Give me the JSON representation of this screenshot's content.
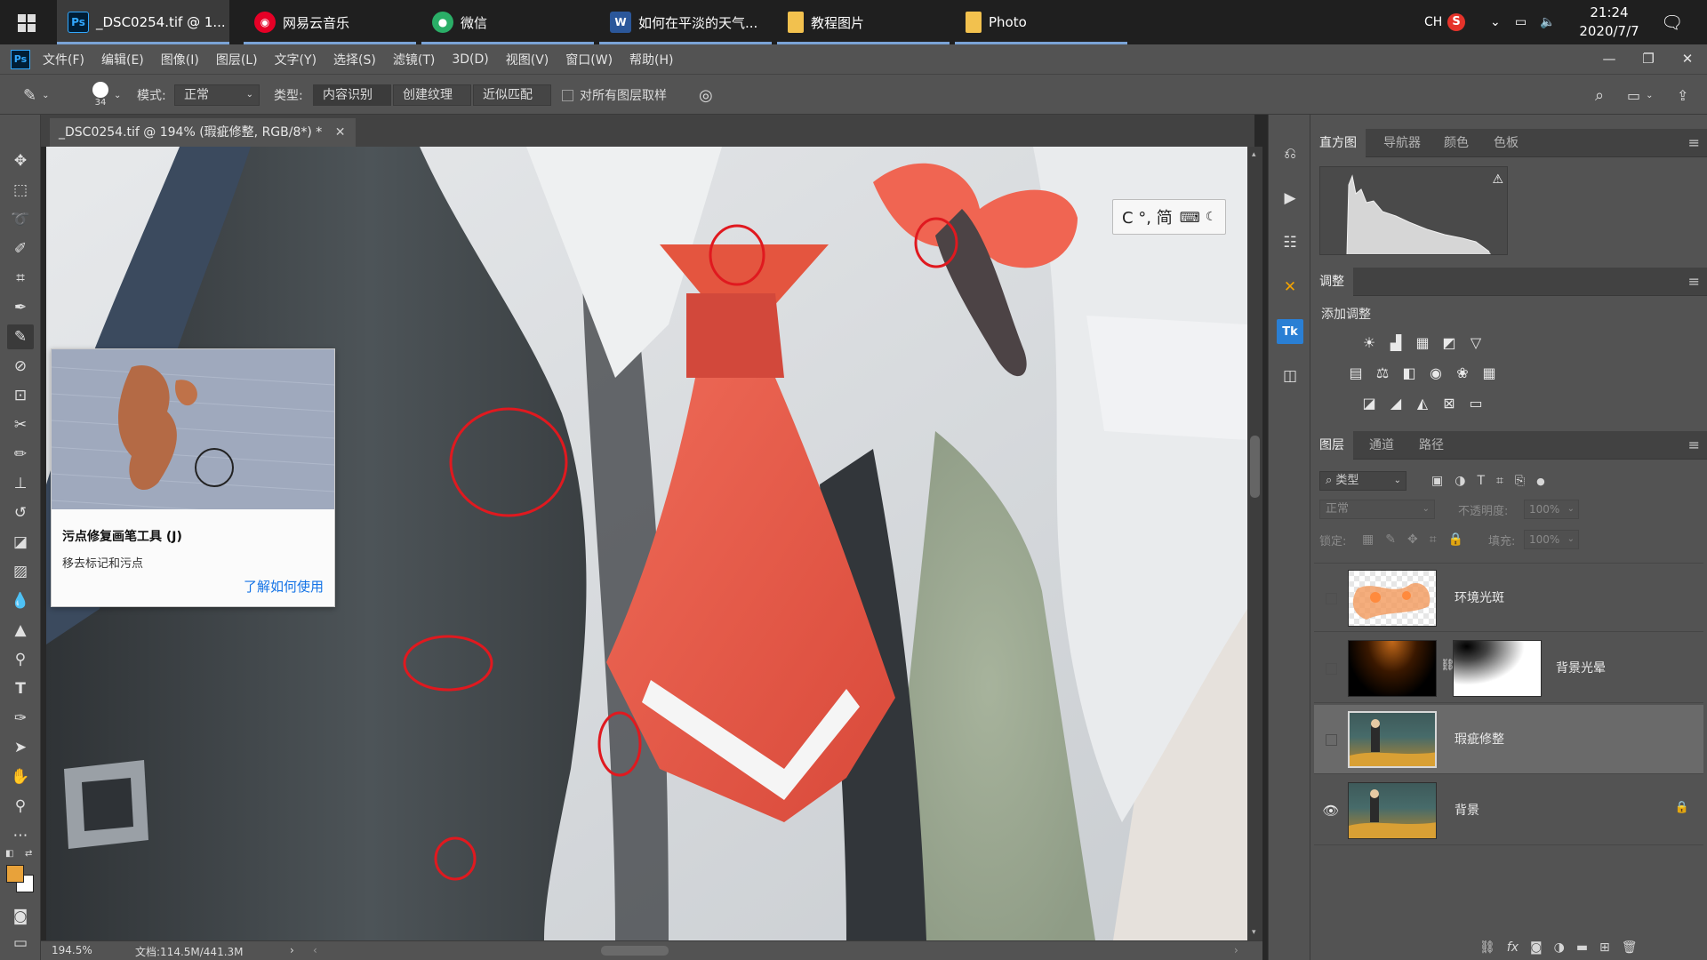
{
  "taskbar": {
    "items": [
      {
        "label": "_DSC0254.tif @ 1...",
        "icon": "photoshop-icon",
        "badge": "Ps",
        "color": "#31a8ff",
        "bg": "#001e36",
        "active": true
      },
      {
        "label": "网易云音乐",
        "icon": "netease-music-icon",
        "badge": "◉",
        "color": "#ffffff",
        "bg": "#e60026",
        "active": false
      },
      {
        "label": "微信",
        "icon": "wechat-icon",
        "badge": "●",
        "color": "#ffffff",
        "bg": "#2aae67",
        "active": false
      },
      {
        "label": "如何在平淡的天气...",
        "icon": "word-icon",
        "badge": "W",
        "color": "#ffffff",
        "bg": "#2b579a",
        "active": false
      },
      {
        "label": "教程图片",
        "icon": "folder-icon",
        "badge": "",
        "color": "#f2c14e",
        "bg": "#f2c14e",
        "active": false
      },
      {
        "label": "Photo",
        "icon": "folder-icon",
        "badge": "",
        "color": "#f2c14e",
        "bg": "#f2c14e",
        "active": false
      }
    ],
    "ime_indicator": "CH",
    "time": "21:24",
    "date": "2020/7/7"
  },
  "menu": {
    "logo": "Ps",
    "items": [
      "文件(F)",
      "编辑(E)",
      "图像(I)",
      "图层(L)",
      "文字(Y)",
      "选择(S)",
      "滤镜(T)",
      "3D(D)",
      "视图(V)",
      "窗口(W)",
      "帮助(H)"
    ]
  },
  "options": {
    "brush_size": "34",
    "mode_label": "模式:",
    "mode_value": "正常",
    "type_label": "类型:",
    "type_options": [
      "内容识别",
      "创建纹理",
      "近似匹配"
    ],
    "type_selected": "内容识别",
    "sample_all_label": "对所有图层取样"
  },
  "document": {
    "tab_title": "_DSC0254.tif @ 194% (瑕疵修整, RGB/8*) *",
    "zoom": "194.5%",
    "doc_size": "文档:114.5M/441.3M"
  },
  "tooltip": {
    "title": "污点修复画笔工具 (J)",
    "description": "移去标记和污点",
    "link": "了解如何使用"
  },
  "ime_bar": {
    "text": "C °, 简"
  },
  "histogram_panel": {
    "tabs": [
      "直方图",
      "导航器",
      "颜色",
      "色板"
    ]
  },
  "adjustments_panel": {
    "tab": "调整",
    "subtitle": "添加调整"
  },
  "layers_panel": {
    "tabs": [
      "图层",
      "通道",
      "路径"
    ],
    "filter_kind": "类型",
    "blend_mode": "正常",
    "opacity_label": "不透明度:",
    "opacity_value": "100%",
    "lock_label": "锁定:",
    "fill_label": "填充:",
    "fill_value": "100%",
    "layers": [
      {
        "name": "环境光斑",
        "visible": false,
        "selected": false,
        "locked": false
      },
      {
        "name": "背景光晕",
        "visible": false,
        "selected": false,
        "locked": false
      },
      {
        "name": "瑕疵修整",
        "visible": false,
        "selected": true,
        "locked": false
      },
      {
        "name": "背景",
        "visible": true,
        "selected": false,
        "locked": true
      }
    ]
  },
  "colors": {
    "foreground": "#e8a23a",
    "background": "#ffffff",
    "annotation_circle": "#e0191f"
  }
}
